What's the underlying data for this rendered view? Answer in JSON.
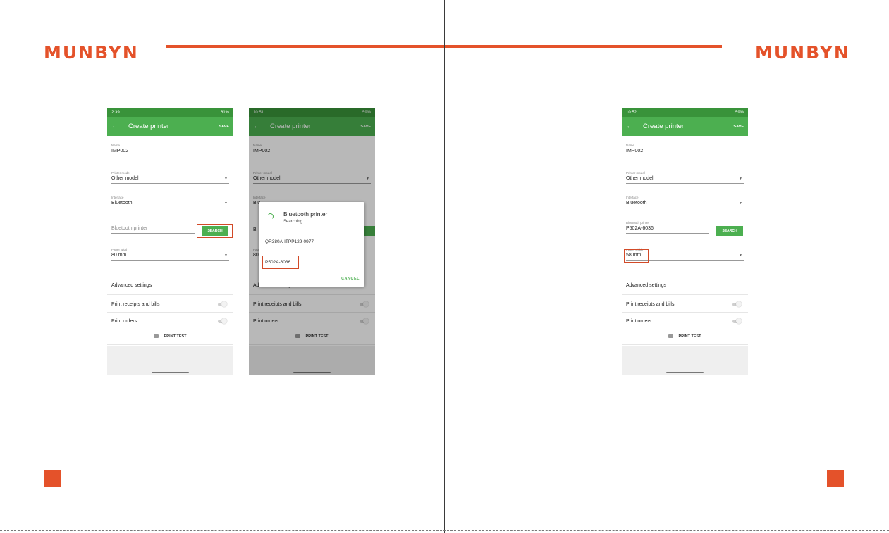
{
  "brand": {
    "logo_text": "MUNBYN",
    "accent": "#e4522a"
  },
  "phones": [
    {
      "status_time": "2:39",
      "status_right": "61%",
      "appbar": {
        "back_icon": "←",
        "title": "Create printer",
        "save_label": "SAVE"
      },
      "name": {
        "label": "Name",
        "value": "IMP002"
      },
      "printer_model": {
        "label": "Printer model",
        "value": "Other model"
      },
      "interface": {
        "label": "Interface",
        "value": "Bluetooth"
      },
      "bt_printer": {
        "label": "",
        "value": "Bluetooth printer"
      },
      "search_label": "SEARCH",
      "paper_width": {
        "label": "Paper width",
        "value": "80 mm"
      },
      "advanced": "Advanced settings",
      "print_receipts": "Print receipts and bills",
      "print_orders": "Print orders",
      "print_test": "PRINT TEST"
    },
    {
      "status_time": "10:51",
      "status_right": "59%",
      "appbar": {
        "back_icon": "←",
        "title": "Create printer",
        "save_label": "SAVE"
      },
      "name": {
        "label": "Name",
        "value": "IMP002"
      },
      "printer_model": {
        "label": "Printer model",
        "value": "Other model"
      },
      "interface": {
        "label": "Interface",
        "value": "Blu"
      },
      "paper_width": {
        "label": "Pap",
        "value": "80"
      },
      "bt_partial": "Bl",
      "advanced": "Advanced settings",
      "print_receipts": "Print receipts and bills",
      "print_orders": "Print orders",
      "print_test": "PRINT TEST",
      "dialog": {
        "title": "Bluetooth printer",
        "subtitle": "Searching...",
        "items": [
          "QR380A-ITPP129-0977",
          "P502A-6036"
        ],
        "cancel": "CANCEL"
      }
    },
    {
      "status_time": "10:52",
      "status_right": "59%",
      "appbar": {
        "back_icon": "←",
        "title": "Create printer",
        "save_label": "SAVE"
      },
      "name": {
        "label": "Name",
        "value": "IMP002"
      },
      "printer_model": {
        "label": "Printer model",
        "value": "Other model"
      },
      "interface": {
        "label": "Interface",
        "value": "Bluetooth"
      },
      "bt_printer": {
        "label": "Bluetooth printer",
        "value": "P502A-6036"
      },
      "search_label": "SEARCH",
      "paper_width": {
        "label": "Paper width",
        "value": "58 mm"
      },
      "advanced": "Advanced settings",
      "print_receipts": "Print receipts and bills",
      "print_orders": "Print orders",
      "print_test": "PRINT TEST"
    }
  ]
}
